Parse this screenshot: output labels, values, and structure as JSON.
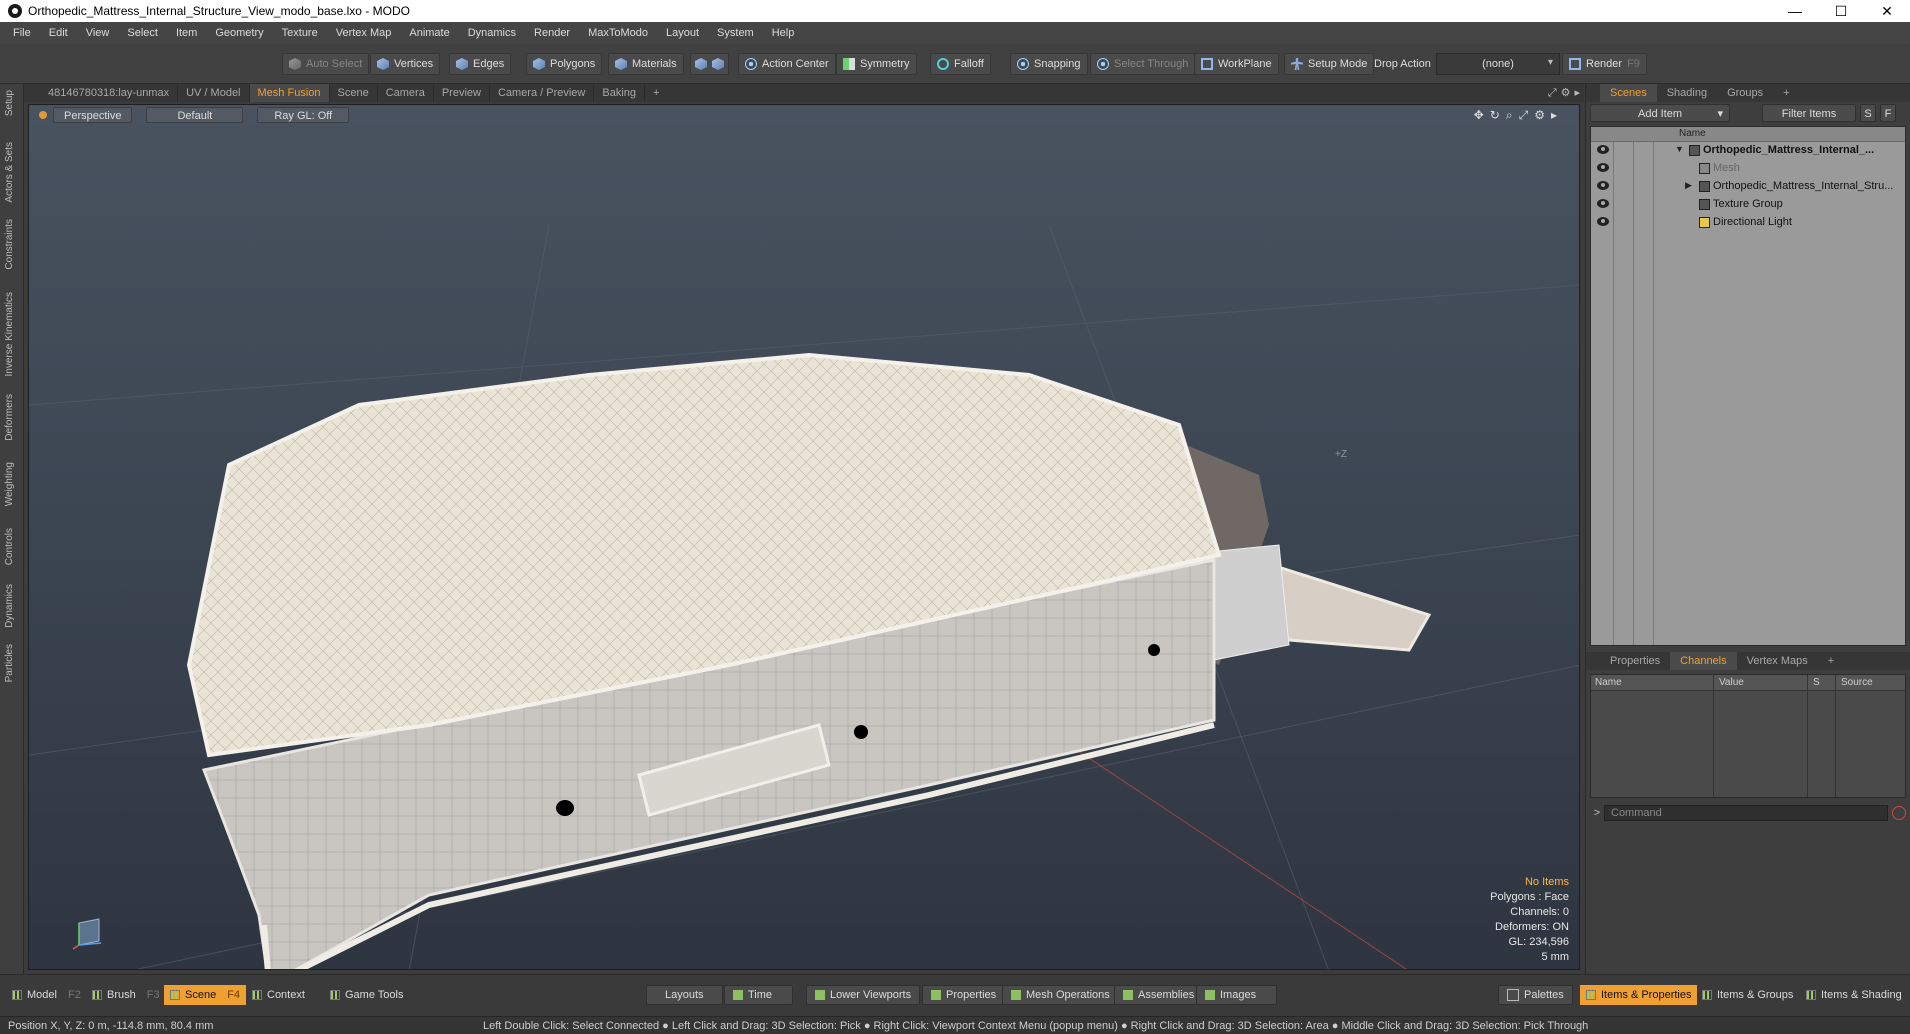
{
  "window": {
    "title": "Orthopedic_Mattress_Internal_Structure_View_modo_base.lxo - MODO",
    "controls": [
      "—",
      "☐",
      "✕"
    ]
  },
  "menu": [
    "File",
    "Edit",
    "View",
    "Select",
    "Item",
    "Geometry",
    "Texture",
    "Vertex Map",
    "Animate",
    "Dynamics",
    "Render",
    "MaxToModo",
    "Layout",
    "System",
    "Help"
  ],
  "toolbar": {
    "auto_select": "Auto Select",
    "vertices": "Vertices",
    "edges": "Edges",
    "polygons": "Polygons",
    "materials": "Materials",
    "action_center": "Action Center",
    "symmetry": "Symmetry",
    "falloff": "Falloff",
    "snapping": "Snapping",
    "select_through": "Select Through",
    "workplane": "WorkPlane",
    "setup_mode": "Setup Mode",
    "drop_action": "Drop Action",
    "drop_action_value": "(none)",
    "render": "Render",
    "render_key": "F9"
  },
  "left_tabs": [
    "Setup",
    "Actors & Sets",
    "Constraints",
    "Inverse Kinematics",
    "Deformers",
    "Weighting",
    "Controls",
    "Dynamics",
    "Particles"
  ],
  "viewport_tabs": [
    "48146780318:lay-unmax",
    "UV / Model",
    "Mesh Fusion",
    "Scene",
    "Camera",
    "Preview",
    "Camera / Preview",
    "Baking",
    "+"
  ],
  "viewport": {
    "projection": "Perspective",
    "shading": "Default",
    "raygl": "Ray GL: Off",
    "info": {
      "selection": "No Items",
      "polygons": "Polygons : Face",
      "channels": "Channels: 0",
      "deformers": "Deformers: ON",
      "gl": "GL: 234,596",
      "grid": "5 mm"
    },
    "axis_label": "+Z"
  },
  "right_panel": {
    "tabs": [
      "Scenes",
      "Shading",
      "Groups",
      "+"
    ],
    "add_item": "Add Item",
    "filter_items": "Filter Items",
    "s_btn": "S",
    "f_btn": "F",
    "tree_header": "Name",
    "tree": [
      {
        "label": "Orthopedic_Mattress_Internal_...",
        "level": 0
      },
      {
        "label": "Mesh",
        "level": 1
      },
      {
        "label": "Orthopedic_Mattress_Internal_Stru...",
        "level": 1
      },
      {
        "label": "Texture Group",
        "level": 1
      },
      {
        "label": "Directional Light",
        "level": 1
      }
    ],
    "lower_tabs": [
      "Properties",
      "Channels",
      "Vertex Maps",
      "+"
    ],
    "channel_headers": [
      "Name",
      "Value",
      "S",
      "Source"
    ],
    "command_placeholder": "Command",
    "command_prompt": ">"
  },
  "bottom": {
    "model": "Model",
    "model_key": "F2",
    "brush": "Brush",
    "brush_key": "F3",
    "scene": "Scene",
    "scene_key": "F4",
    "context": "Context",
    "game_tools": "Game Tools",
    "layouts": "Layouts",
    "time": "Time",
    "lower_viewports": "Lower Viewports",
    "properties": "Properties",
    "mesh_operations": "Mesh Operations",
    "assemblies": "Assemblies",
    "images": "Images",
    "palettes": "Palettes",
    "items_properties": "Items & Properties",
    "items_groups": "Items & Groups",
    "items_shading": "Items & Shading"
  },
  "status": {
    "position": "Position X, Y, Z:  0 m, -114.8 mm, 80.4 mm",
    "hint": "Left Double Click: Select Connected ● Left Click and Drag: 3D Selection: Pick ● Right Click: Viewport Context Menu (popup menu) ● Right Click and Drag: 3D Selection: Area ● Middle Click and Drag: 3D Selection: Pick Through"
  }
}
